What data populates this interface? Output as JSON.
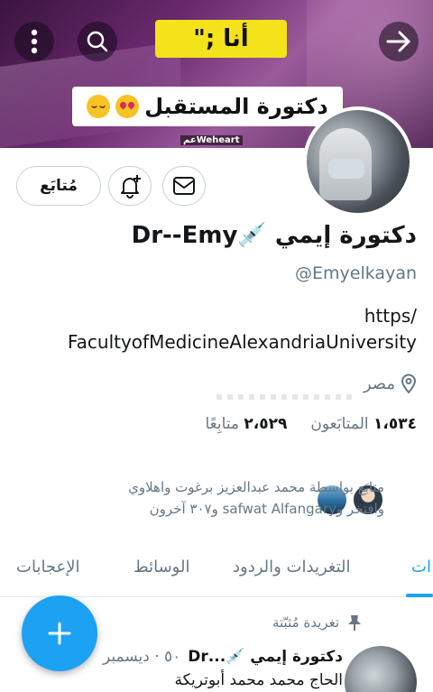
{
  "banner": {
    "sticker_top": "أنا ;\"",
    "sticker_bottom": "دكتورة المستقبل",
    "watermark": "عمWeheart"
  },
  "actions": {
    "follow_label": "مُتابَع"
  },
  "profile": {
    "name": "دكتورة إيمي 💉Dr--Emy",
    "handle": "@Emyelkayan",
    "bio_line1": "https/",
    "bio_line2": "FacultyofMedicineAlexandriaUniversity",
    "location": "مصر"
  },
  "stats": {
    "following_count": "١،٥٣٤",
    "following_label": "المتابَعون",
    "followers_count": "٢،٥٢٩",
    "followers_label": "متابِعًا"
  },
  "followed_by": {
    "line1": "متابَع بواسطة محمد عبدالعزيز برغوت واهلاوي",
    "line2": "وافتخر وsafwat Alfangary و٣٠٧ آخرون"
  },
  "tabs": [
    {
      "label": "ات"
    },
    {
      "label": "التغريدات والردود"
    },
    {
      "label": "الوسائط"
    },
    {
      "label": "الإعجابات"
    }
  ],
  "pinned_tweet": {
    "pinned_label": "تغريدة مُثبّتة",
    "author": "دكتورة إيمي 💉...Dr",
    "meta": "٥٠ · ديسمبر",
    "text": "الحاج محمد محمد أبوتريكة"
  },
  "colors": {
    "accent": "#1da1f2",
    "muted": "#657786",
    "sticker_yellow": "#f4e21a"
  },
  "icons": [
    "more-vertical-icon",
    "search-icon",
    "arrow-right-icon",
    "mail-icon",
    "bell-plus-icon",
    "location-pin-icon",
    "pin-icon",
    "plus-icon"
  ]
}
